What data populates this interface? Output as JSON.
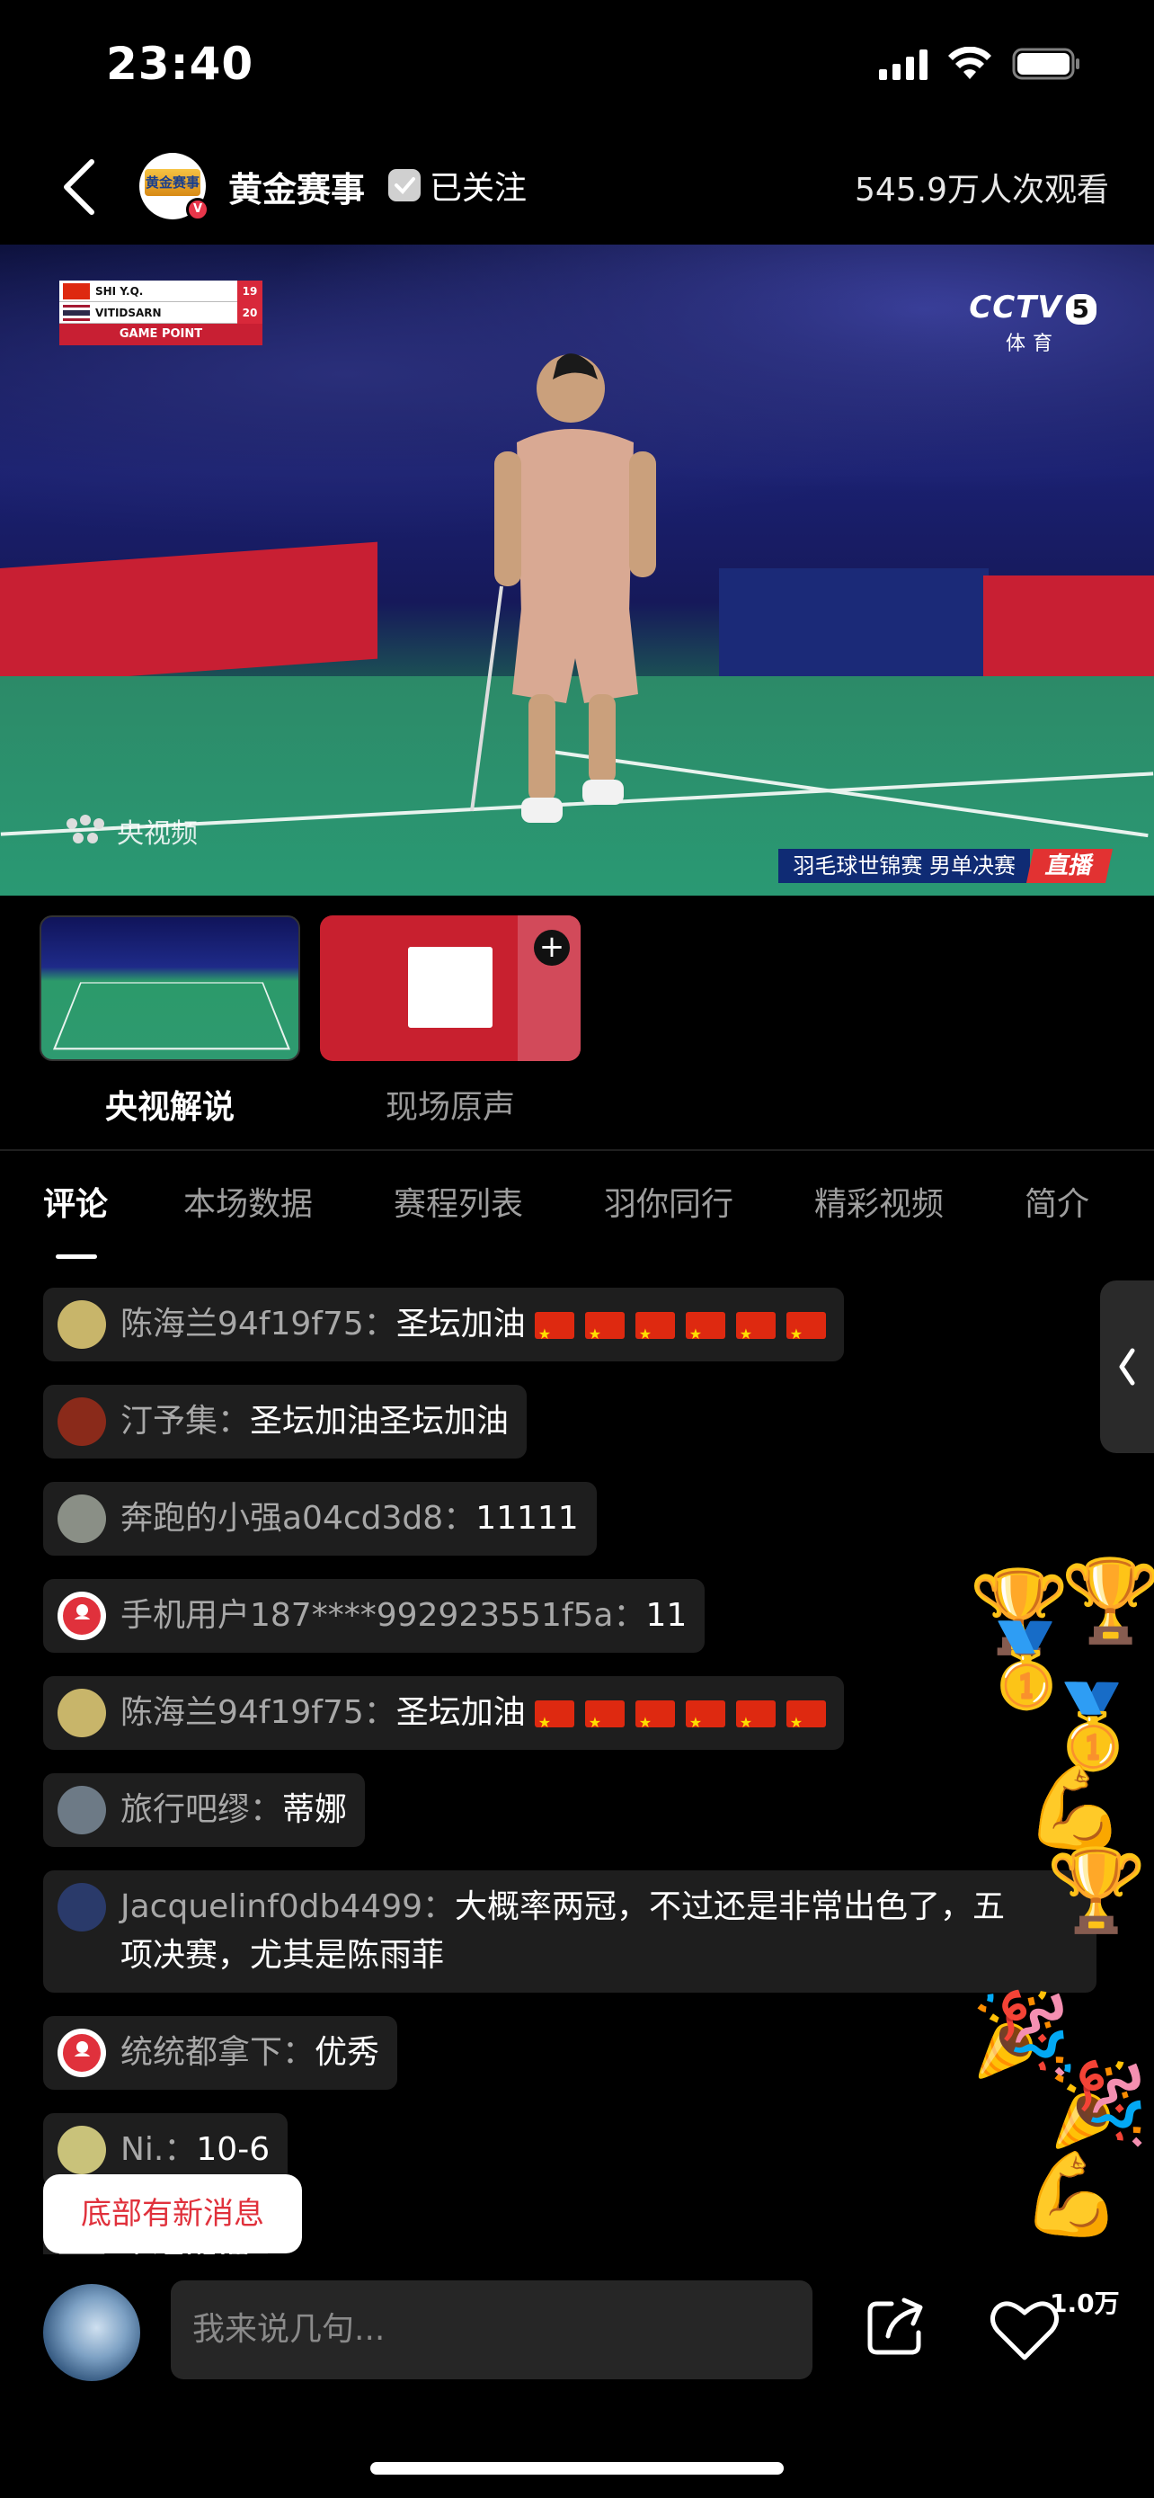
{
  "status_bar": {
    "time": "23:40"
  },
  "header": {
    "channel_name": "黄金赛事",
    "channel_logo_text": "黄金赛事",
    "follow_label": "已关注",
    "viewers": "545.9万人次观看"
  },
  "video": {
    "scoreboard": {
      "rows": [
        {
          "player": "SHI Y.Q.",
          "points": "19"
        },
        {
          "player": "VITIDSARN",
          "points": "20"
        }
      ],
      "status": "GAME POINT"
    },
    "channel_logo": "CCTV",
    "channel_number": "5",
    "channel_sub": "体育",
    "watermark": "央视频",
    "caption": "羽毛球世锦赛  男单决赛",
    "live_label": "直播"
  },
  "commentary_options": [
    {
      "label": "央视解说",
      "active": true
    },
    {
      "label": "现场原声",
      "active": false
    }
  ],
  "tabs": [
    "评论",
    "本场数据",
    "赛程列表",
    "羽你同行",
    "精彩视频",
    "简介"
  ],
  "comments": [
    {
      "name": "陈海兰94f19f75：",
      "text": "圣坛加油",
      "flags": 6,
      "avatar_color": "#c8b56a"
    },
    {
      "name": "汀予集：",
      "text": "圣坛加油圣坛加油",
      "flags": 0,
      "avatar_color": "#8a2a1a"
    },
    {
      "name": "奔跑的小强a04cd3d8：",
      "text": "11111",
      "flags": 0,
      "avatar_color": "#8a8f86"
    },
    {
      "name": "手机用户187****992923551f5a：",
      "text": "11",
      "flags": 0,
      "avatar_color": "user"
    },
    {
      "name": "陈海兰94f19f75：",
      "text": "圣坛加油",
      "flags": 6,
      "avatar_color": "#c8b56a"
    },
    {
      "name": "旅行吧缪：",
      "text": "蒂娜",
      "flags": 0,
      "avatar_color": "#6d7a86"
    },
    {
      "name": "Jacquelinf0db4499：",
      "text": "大概率两冠，不过还是非常出色了，五",
      "text2": "项决赛，尤其是陈雨菲",
      "flags": 0,
      "avatar_color": "#2a3a6a"
    },
    {
      "name": "统统都拿下：",
      "text": "优秀",
      "flags": 0,
      "avatar_color": "user"
    },
    {
      "name": "Ni.：",
      "text": "10-6",
      "flags": 0,
      "avatar_color": "#c9c27a"
    },
    {
      "name": "",
      "text": "圣坛加油",
      "flags": 0,
      "avatar_color": "#888"
    }
  ],
  "new_message_label": "底部有新消息",
  "input_placeholder": "我来说几句...",
  "like_count": "1.0万",
  "colors": {
    "accent_red": "#e0313c",
    "background": "#000000",
    "comment_bg": "#1e1e1e"
  }
}
